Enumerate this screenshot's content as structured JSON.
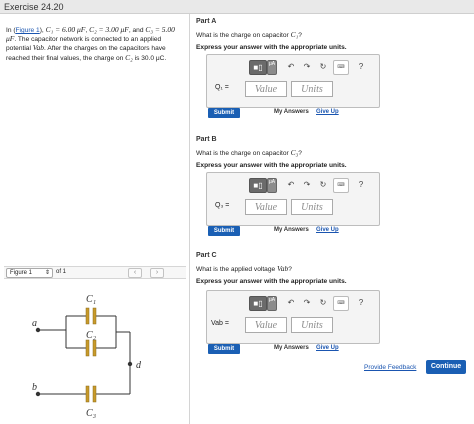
{
  "header": {
    "title": "Exercise 24.20"
  },
  "problem": {
    "intro": "In (",
    "figure_link": "Figure 1",
    "text1": "), ",
    "c1": "C₁ = 6.00 μF",
    "c2": "C₂ = 3.00 μF",
    "c3_line": "C₃ = 5.00 μF",
    "text2": ". The capacitor network is connected to an applied potential ",
    "vab": "Vab",
    "text3": ". After the charges on the capacitors have reached their final values, the charge on ",
    "c2_sym": "C₂",
    "text4": " is 30.0 μC."
  },
  "figure_nav": {
    "selector_value": "Figure 1",
    "of_label": "of 1",
    "prev_icon": "chevron-left-icon",
    "next_icon": "chevron-right-icon"
  },
  "circuit": {
    "labels": {
      "c1": "C₁",
      "c2": "C₂",
      "c3": "C₃",
      "a": "a",
      "b": "b",
      "d": "d"
    }
  },
  "parts": [
    {
      "title": "Part A",
      "question_prefix": "What is the charge on capacitor ",
      "question_symbol": "C₁",
      "question_suffix": "?",
      "instruction": "Express your answer with the appropriate units.",
      "variable": "Q₁ =",
      "value_placeholder": "Value",
      "units_placeholder": "Units"
    },
    {
      "title": "Part B",
      "question_prefix": "What is the charge on capacitor ",
      "question_symbol": "C₃",
      "question_suffix": "?",
      "instruction": "Express your answer with the appropriate units.",
      "variable": "Q₃ =",
      "value_placeholder": "Value",
      "units_placeholder": "Units"
    },
    {
      "title": "Part C",
      "question_prefix": "What is the applied voltage ",
      "question_symbol": "Vab",
      "question_suffix": "?",
      "instruction": "Express your answer with the appropriate units.",
      "variable": "Vab =",
      "value_placeholder": "Value",
      "units_placeholder": "Units"
    }
  ],
  "toolbar": {
    "template_icon": "template-icon",
    "mu_label": "μA",
    "undo_icon": "undo-icon",
    "redo_icon": "redo-icon",
    "reset_icon": "reset-icon",
    "keyboard_icon": "keyboard-icon",
    "keyboard_label": "⌨",
    "help_label": "?"
  },
  "actions": {
    "submit_label": "Submit",
    "my_answers_label": "My Answers",
    "give_up_label": "Give Up"
  },
  "footer": {
    "feedback_label": "Provide Feedback",
    "continue_label": "Continue"
  },
  "colors": {
    "accent": "#1a5fb4",
    "link": "#1a55b0",
    "capacitor": "#c89a2a"
  }
}
